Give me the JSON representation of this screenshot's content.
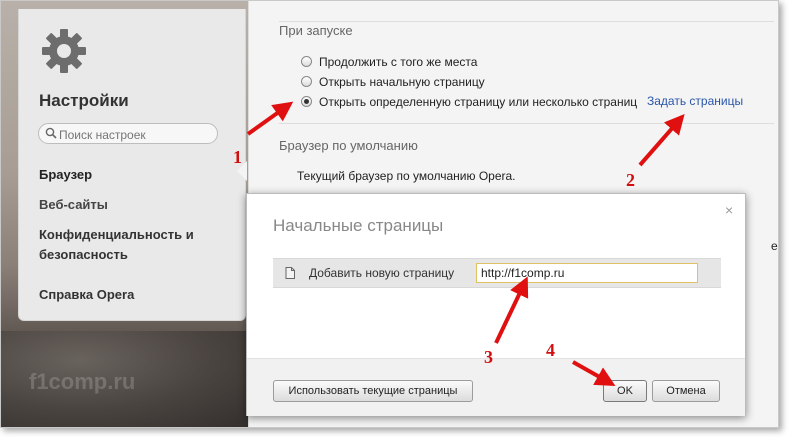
{
  "sidebar": {
    "title": "Настройки",
    "search_placeholder": "Поиск настроек",
    "items": [
      {
        "label": "Браузер"
      },
      {
        "label": "Веб-сайты"
      },
      {
        "label": "Конфиденциальность и безопасность"
      },
      {
        "label": "Справка Opera"
      }
    ]
  },
  "main": {
    "startup_title": "При запуске",
    "startup_options": [
      {
        "label": "Продолжить с того же места",
        "selected": false
      },
      {
        "label": "Открыть начальную страницу",
        "selected": false
      },
      {
        "label": "Открыть определенную страницу или несколько страниц",
        "selected": true
      }
    ],
    "set_pages_link": "Задать страницы",
    "default_title": "Браузер по умолчанию",
    "default_text": "Текущий браузер по умолчанию Opera.",
    "clipped_text": "е"
  },
  "dialog": {
    "title": "Начальные страницы",
    "close_glyph": "×",
    "add_label": "Добавить новую страницу",
    "add_value": "http://f1comp.ru",
    "use_current_button": "Использовать текущие страницы",
    "ok_button": "OK",
    "cancel_button": "Отмена"
  },
  "annotations": {
    "numbers": [
      "1",
      "2",
      "3",
      "4"
    ],
    "arrow_color": "#e01010"
  },
  "watermark": "f1comp.ru"
}
